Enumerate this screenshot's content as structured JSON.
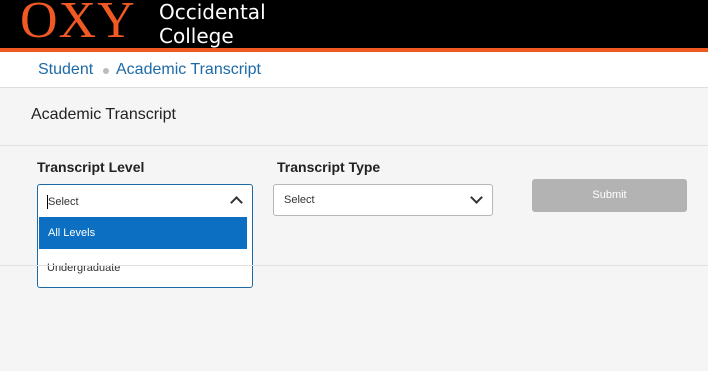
{
  "header": {
    "logo_text": "OXY",
    "college_line1": "Occidental",
    "college_line2": "College",
    "colors": {
      "bar": "#000000",
      "accent": "#f05a22"
    }
  },
  "breadcrumb": {
    "items": [
      "Student",
      "Academic Transcript"
    ]
  },
  "page": {
    "title": "Academic Transcript"
  },
  "form": {
    "transcript_level": {
      "label": "Transcript Level",
      "value": "Select",
      "options": [
        "All Levels",
        "Undergraduate"
      ],
      "highlighted": "All Levels"
    },
    "transcript_type": {
      "label": "Transcript Type",
      "value": "Select"
    },
    "submit_label": "Submit"
  },
  "icons": {
    "level_toggle": "chevron-up-icon",
    "type_toggle": "chevron-down-icon"
  },
  "colors": {
    "link": "#1c6aa8",
    "highlight": "#0c6fc2",
    "submit_disabled": "#b3b3b3"
  }
}
